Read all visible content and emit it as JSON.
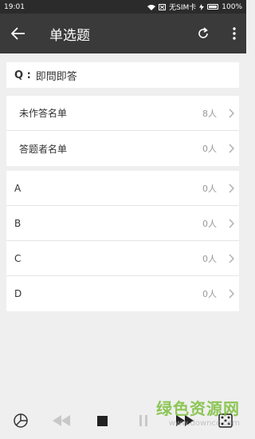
{
  "status": {
    "time": "19:01",
    "sim": "无SIM卡",
    "battery": "100%"
  },
  "appbar": {
    "title": "单选题",
    "back_icon": "back-arrow-icon",
    "refresh_icon": "refresh-icon",
    "menu_icon": "more-vert-icon"
  },
  "question": {
    "prefix": "Q :",
    "text": "即問即答"
  },
  "summary": [
    {
      "label": "未作答名单",
      "count": "8人"
    },
    {
      "label": "答题者名单",
      "count": "0人"
    }
  ],
  "options": [
    {
      "label": "A",
      "count": "0人"
    },
    {
      "label": "B",
      "count": "0人"
    },
    {
      "label": "C",
      "count": "0人"
    },
    {
      "label": "D",
      "count": "0人"
    }
  ],
  "bottom": {
    "icons": [
      "pie-chart-icon",
      "rewind-icon",
      "stop-icon",
      "pause-icon",
      "fast-forward-icon",
      "dice-icon"
    ]
  },
  "watermark": {
    "title": "绿色资源网",
    "url": "www.downcc.com"
  }
}
